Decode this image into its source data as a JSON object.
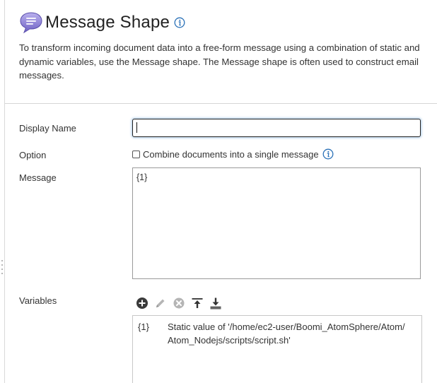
{
  "header": {
    "title": "Message Shape",
    "shape_icon": "speech-bubble-icon",
    "info_icon": "info-icon"
  },
  "description": "To transform incoming document data into a free-form message using a combination of static and dynamic variables, use the Message shape. The Message shape is often used to construct email messages.",
  "form": {
    "display_name": {
      "label": "Display Name",
      "value": ""
    },
    "option": {
      "label": "Option",
      "checkbox_label": "Combine documents into a single message",
      "checked": false
    },
    "message": {
      "label": "Message",
      "value": "{1}"
    },
    "variables": {
      "label": "Variables",
      "toolbar": {
        "add": "add-icon",
        "edit": "edit-pencil-icon",
        "delete": "delete-icon",
        "move_up": "move-to-top-icon",
        "move_down": "move-to-bottom-icon"
      },
      "items": [
        {
          "token": "{1}",
          "description": "Static value of '/home/ec2-user/Boomi_AtomSphere/Atom/Atom_Nodejs/scripts/script.sh'"
        }
      ]
    }
  },
  "colors": {
    "icon_purple": "#7b6fc9",
    "info_blue": "#2c72b8",
    "focus_glow": "#a9c9e6",
    "divider": "#d6d6d6"
  }
}
